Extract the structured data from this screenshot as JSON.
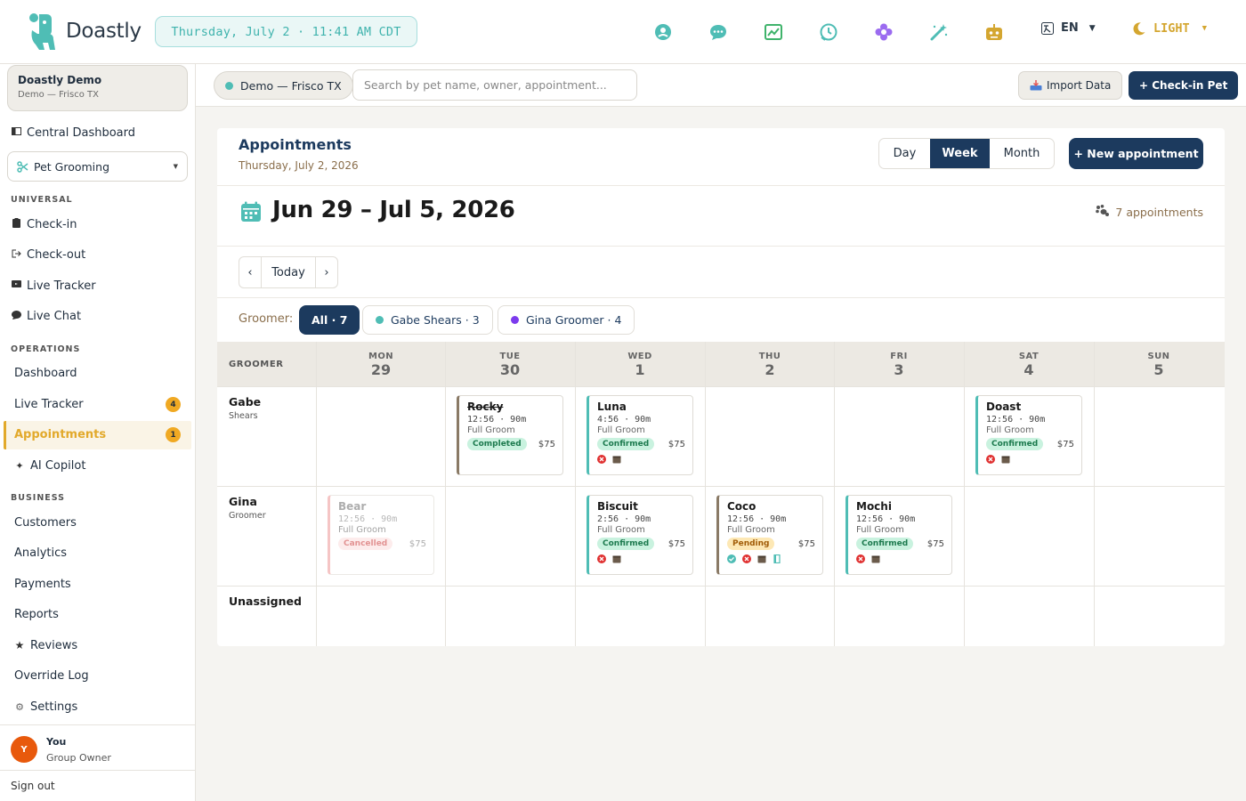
{
  "app": {
    "name": "Doastly",
    "clock": "Thursday, July 2 · 11:41 AM CDT",
    "language": "EN",
    "theme": "LIGHT",
    "top_icons": [
      "support-icon",
      "chat-icon",
      "analytics-icon",
      "history-icon",
      "flower-icon",
      "magic-wand-icon",
      "robot-icon"
    ]
  },
  "sidebar": {
    "org_name": "Doastly Demo",
    "org_sub": "Demo — Frisco TX",
    "central_dashboard": "Central Dashboard",
    "module": "Pet Grooming",
    "sections": {
      "universal": "UNIVERSAL",
      "operations": "OPERATIONS",
      "business": "BUSINESS"
    },
    "universal_items": [
      "Check-in",
      "Check-out",
      "Live Tracker",
      "Live Chat"
    ],
    "operations_items": [
      "Dashboard",
      "Live Tracker",
      "Appointments",
      "AI Copilot"
    ],
    "operations_badges": {
      "live_tracker": "4",
      "appointments": "1"
    },
    "business_items": [
      "Customers",
      "Analytics",
      "Payments",
      "Reports",
      "Reviews",
      "Override Log",
      "Settings"
    ],
    "user": {
      "initial": "Y",
      "name": "You",
      "role": "Group Owner"
    },
    "sign_out": "Sign out"
  },
  "toolbar": {
    "location": "Demo — Frisco TX",
    "search_placeholder": "Search by pet name, owner, appointment...",
    "import_label": "Import Data",
    "checkin_label": "+ Check-in Pet"
  },
  "main": {
    "title": "Appointments",
    "date": "Thursday, July 2, 2026",
    "views": [
      "Day",
      "Week",
      "Month"
    ],
    "active_view": "Week",
    "new_appt_label": "+ New appointment",
    "range": "Jun 29 – Jul 5, 2026",
    "appt_count": "7 appointments",
    "nav": {
      "prev": "‹",
      "today": "Today",
      "next": "›"
    },
    "groomer_label": "Groomer:",
    "filters": [
      {
        "label": "All · 7",
        "active": true
      },
      {
        "label": "Gabe Shears · 3",
        "color": "#4fbdb5"
      },
      {
        "label": "Gina Groomer · 4",
        "color": "#7c3aed"
      }
    ]
  },
  "calendar": {
    "groomer_header": "GROOMER",
    "days": [
      {
        "dow": "MON",
        "num": "29"
      },
      {
        "dow": "TUE",
        "num": "30"
      },
      {
        "dow": "WED",
        "num": "1"
      },
      {
        "dow": "THU",
        "num": "2"
      },
      {
        "dow": "FRI",
        "num": "3"
      },
      {
        "dow": "SAT",
        "num": "4"
      },
      {
        "dow": "SUN",
        "num": "5"
      }
    ],
    "rows": [
      {
        "name": "Gabe",
        "sub": "Shears"
      },
      {
        "name": "Gina",
        "sub": "Groomer"
      },
      {
        "name": "Unassigned",
        "sub": ""
      }
    ],
    "appointments": [
      {
        "pet": "Rocky",
        "time": "12:56 · 90m",
        "service": "Full Groom",
        "status": "Completed",
        "price": "$75"
      },
      {
        "pet": "Luna",
        "time": "4:56 · 90m",
        "service": "Full Groom",
        "status": "Confirmed",
        "price": "$75"
      },
      {
        "pet": "Doast",
        "time": "12:56 · 90m",
        "service": "Full Groom",
        "status": "Confirmed",
        "price": "$75"
      },
      {
        "pet": "Bear",
        "time": "12:56 · 90m",
        "service": "Full Groom",
        "status": "Cancelled",
        "price": "$75"
      },
      {
        "pet": "Biscuit",
        "time": "2:56 · 90m",
        "service": "Full Groom",
        "status": "Confirmed",
        "price": "$75"
      },
      {
        "pet": "Coco",
        "time": "12:56 · 90m",
        "service": "Full Groom",
        "status": "Pending",
        "price": "$75"
      },
      {
        "pet": "Mochi",
        "time": "12:56 · 90m",
        "service": "Full Groom",
        "status": "Confirmed",
        "price": "$75"
      }
    ]
  },
  "colors": {
    "primary": "#1c3a5e",
    "accent": "#e2a92b",
    "teal": "#4fbdb5",
    "confirmed_bg": "#c9f2df",
    "confirmed_fg": "#1c7a4e",
    "pending_bg": "#fde8b5",
    "cancelled_bg": "#fde1e1"
  }
}
